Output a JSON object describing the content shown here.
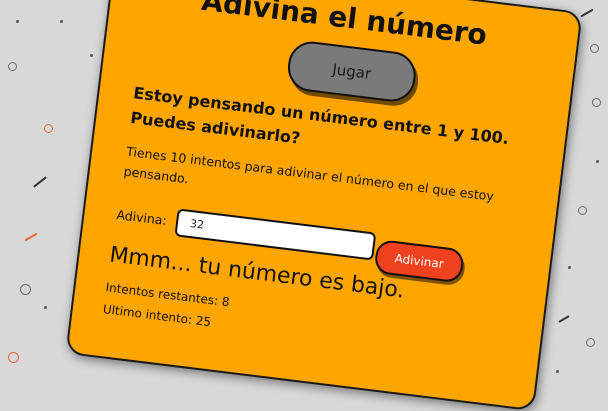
{
  "game": {
    "title": "Adivina el número",
    "play_button": "Jugar",
    "heading": "Estoy pensando un número entre 1 y 100. Puedes adivinarlo?",
    "intro": "Tienes 10 intentos para adivinar el número en el que estoy pensando.",
    "guess_label": "Adivina:",
    "guess_value": "32",
    "guess_button": "Adivinar",
    "feedback": "Mmm... tu número es bajo.",
    "remaining_text": "Intentos restantes: 8",
    "last_text": "Ultimo intento: 25"
  },
  "colors": {
    "background": "#d8d8d8",
    "card": "#ffa500",
    "play_button": "#7a7a7a",
    "guess_button": "#f0411e"
  }
}
